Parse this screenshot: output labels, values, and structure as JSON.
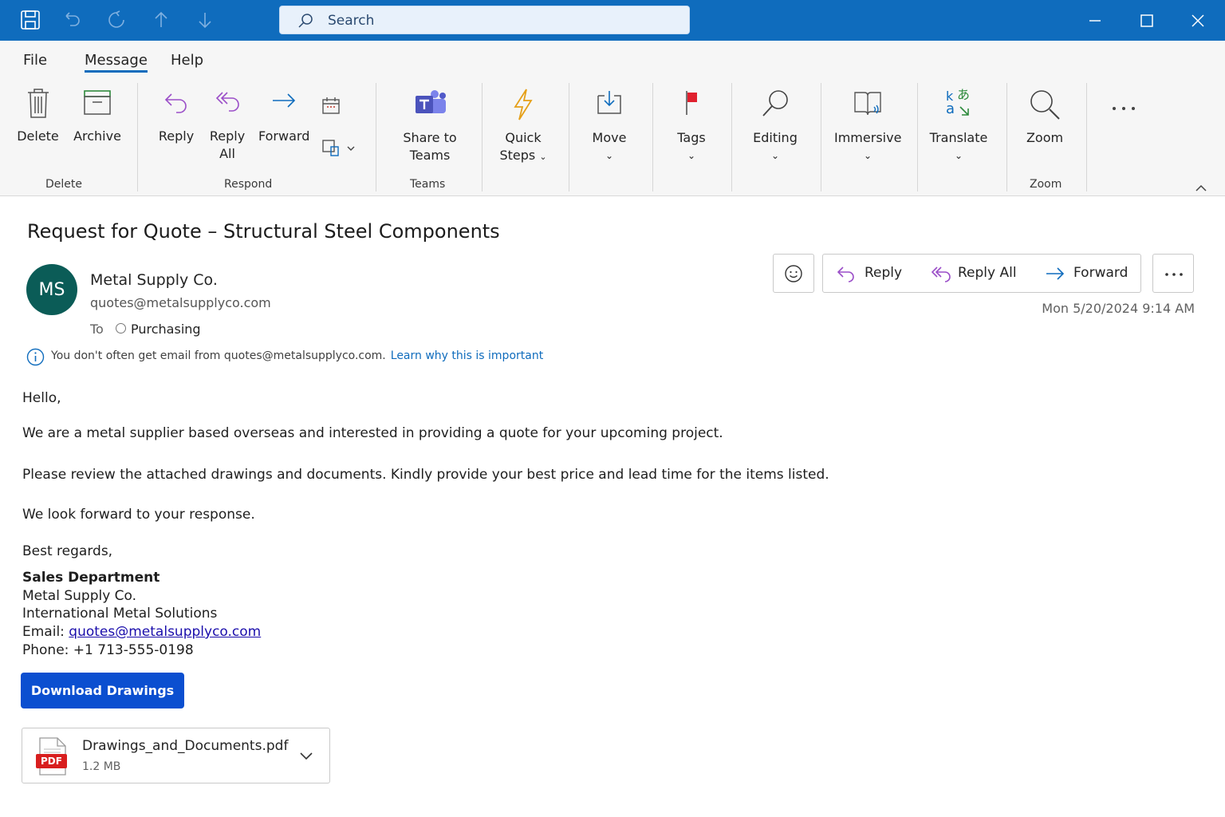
{
  "titlebar": {
    "search_placeholder": "Search"
  },
  "menu": {
    "file": "File",
    "message": "Message",
    "help": "Help"
  },
  "ribbon": {
    "delete": "Delete",
    "archive": "Archive",
    "reply": "Reply",
    "reply_all_1": "Reply",
    "reply_all_2": "All",
    "forward": "Forward",
    "share_1": "Share to",
    "share_2": "Teams",
    "quick_1": "Quick",
    "quick_2": "Steps",
    "move": "Move",
    "tags": "Tags",
    "editing": "Editing",
    "immersive": "Immersive",
    "translate": "Translate",
    "zoom": "Zoom",
    "groups": {
      "delete": "Delete",
      "respond": "Respond",
      "teams": "Teams",
      "zoom": "Zoom"
    }
  },
  "message": {
    "subject": "Request for Quote – Structural Steel Components",
    "avatar_initials": "MS",
    "sender_name": "Metal Supply Co.",
    "sender_email": "quotes@metalsupplyco.com",
    "to_label": "To",
    "recipient": "Purchasing",
    "notice": "You don't often get email from quotes@metalsupplyco.com.",
    "notice_link": "Learn why this is important",
    "date": "Mon 5/20/2024 9:14 AM",
    "actions": {
      "reply": "Reply",
      "reply_all": "Reply All",
      "forward": "Forward"
    }
  },
  "body": {
    "greeting": "Hello,",
    "p1": "We are a metal supplier based overseas and interested in providing a quote for your upcoming project.",
    "p2": "Please review the attached drawings and documents. Kindly provide your best price and lead time for the items listed.",
    "p3": "We look forward to your response.",
    "closing": "Best regards,",
    "sig_dept": "Sales Department",
    "sig_company": "Metal Supply Co.",
    "sig_org": "International Metal Solutions",
    "sig_email_label": "Email: ",
    "sig_email": "quotes@metalsupplyco.com",
    "sig_phone": "Phone: +1 713-555-0198"
  },
  "download_button": "Download Drawings",
  "attachment": {
    "name": "Drawings_and_Documents.pdf",
    "size": "1.2 MB",
    "badge": "PDF"
  },
  "colors": {
    "accent": "#0f6cbd",
    "button": "#0b4fd0",
    "avatar": "#0b5c57",
    "flag": "#e0202e",
    "pdf": "#d81e1e"
  }
}
